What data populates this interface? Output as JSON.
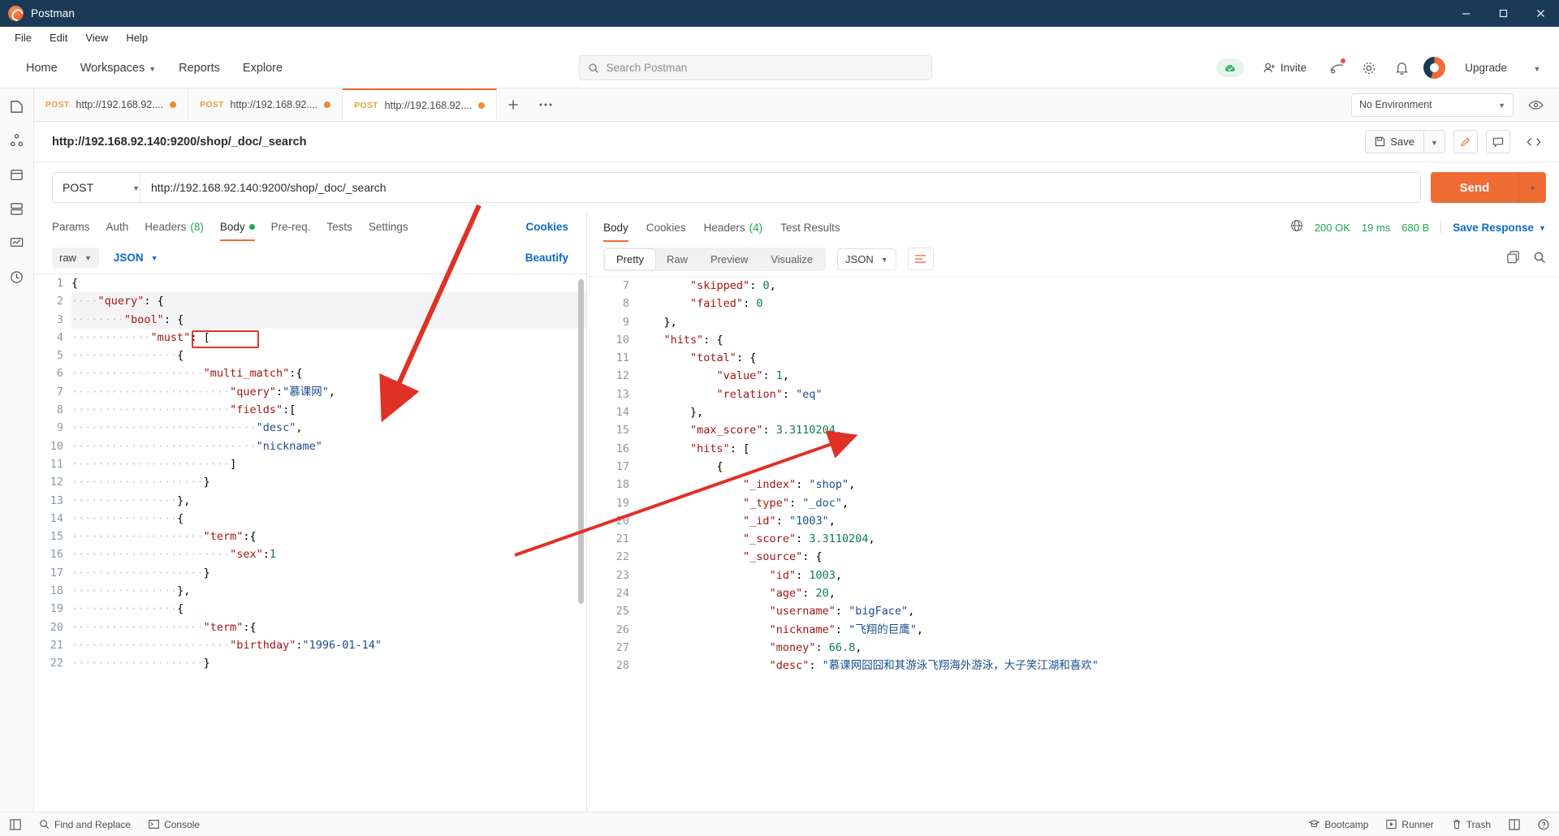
{
  "window": {
    "title": "Postman",
    "minimize": "–",
    "maximize": "❐",
    "close": "✕"
  },
  "menubar": [
    "File",
    "Edit",
    "View",
    "Help"
  ],
  "topnav": {
    "links": [
      "Home",
      "Workspaces",
      "Reports",
      "Explore"
    ],
    "search_placeholder": "Search Postman",
    "invite_label": "Invite",
    "upgrade_label": "Upgrade"
  },
  "tabs": [
    {
      "method": "POST",
      "url": "http://192.168.92....",
      "active": false
    },
    {
      "method": "POST",
      "url": "http://192.168.92....",
      "active": false
    },
    {
      "method": "POST",
      "url": "http://192.168.92....",
      "active": true
    }
  ],
  "environment": {
    "selected": "No Environment"
  },
  "request": {
    "title": "http://192.168.92.140:9200/shop/_doc/_search",
    "save_label": "Save",
    "method": "POST",
    "url": "http://192.168.92.140:9200/shop/_doc/_search",
    "send_label": "Send",
    "tabs": [
      {
        "label": "Params",
        "active": false
      },
      {
        "label": "Auth",
        "active": false
      },
      {
        "label": "Headers",
        "count": "(8)",
        "active": false
      },
      {
        "label": "Body",
        "active": true,
        "dot": true
      },
      {
        "label": "Pre-req.",
        "active": false
      },
      {
        "label": "Tests",
        "active": false
      },
      {
        "label": "Settings",
        "active": false
      }
    ],
    "cookies_link": "Cookies",
    "body_mode": "raw",
    "body_language": "JSON",
    "beautify_label": "Beautify",
    "body_lines": [
      {
        "n": 1,
        "indent": 0,
        "text": "{"
      },
      {
        "n": 2,
        "indent": 1,
        "text": "\"query\": {"
      },
      {
        "n": 3,
        "indent": 2,
        "text": "\"bool\": {"
      },
      {
        "n": 4,
        "indent": 3,
        "text": "\"must\": ["
      },
      {
        "n": 5,
        "indent": 4,
        "text": "{"
      },
      {
        "n": 6,
        "indent": 5,
        "text": "\"multi_match\":{"
      },
      {
        "n": 7,
        "indent": 6,
        "text": "\"query\":\"慕课网\","
      },
      {
        "n": 8,
        "indent": 6,
        "text": "\"fields\":["
      },
      {
        "n": 9,
        "indent": 7,
        "text": "\"desc\","
      },
      {
        "n": 10,
        "indent": 7,
        "text": "\"nickname\""
      },
      {
        "n": 11,
        "indent": 6,
        "text": "]"
      },
      {
        "n": 12,
        "indent": 5,
        "text": "}"
      },
      {
        "n": 13,
        "indent": 4,
        "text": "},"
      },
      {
        "n": 14,
        "indent": 4,
        "text": "{"
      },
      {
        "n": 15,
        "indent": 5,
        "text": "\"term\":{"
      },
      {
        "n": 16,
        "indent": 6,
        "text": "\"sex\":1"
      },
      {
        "n": 17,
        "indent": 5,
        "text": "}"
      },
      {
        "n": 18,
        "indent": 4,
        "text": "},"
      },
      {
        "n": 19,
        "indent": 4,
        "text": "{"
      },
      {
        "n": 20,
        "indent": 5,
        "text": "\"term\":{"
      },
      {
        "n": 21,
        "indent": 6,
        "text": "\"birthday\":\"1996-01-14\""
      },
      {
        "n": 22,
        "indent": 5,
        "text": "}"
      }
    ],
    "annotation_box_label": "\"must\":"
  },
  "response": {
    "tabs": [
      {
        "label": "Body",
        "active": true
      },
      {
        "label": "Cookies",
        "active": false
      },
      {
        "label": "Headers",
        "count": "(4)",
        "active": false
      },
      {
        "label": "Test Results",
        "active": false
      }
    ],
    "status": "200 OK",
    "time": "19 ms",
    "size": "680 B",
    "save_response_label": "Save Response",
    "view_modes": [
      {
        "label": "Pretty",
        "active": true
      },
      {
        "label": "Raw",
        "active": false
      },
      {
        "label": "Preview",
        "active": false
      },
      {
        "label": "Visualize",
        "active": false
      }
    ],
    "language": "JSON",
    "body_lines": [
      {
        "n": 7,
        "indent": 2,
        "text": "\"skipped\": 0,"
      },
      {
        "n": 8,
        "indent": 2,
        "text": "\"failed\": 0"
      },
      {
        "n": 9,
        "indent": 1,
        "text": "},"
      },
      {
        "n": 10,
        "indent": 1,
        "text": "\"hits\": {"
      },
      {
        "n": 11,
        "indent": 2,
        "text": "\"total\": {"
      },
      {
        "n": 12,
        "indent": 3,
        "text": "\"value\": 1,"
      },
      {
        "n": 13,
        "indent": 3,
        "text": "\"relation\": \"eq\""
      },
      {
        "n": 14,
        "indent": 2,
        "text": "},"
      },
      {
        "n": 15,
        "indent": 2,
        "text": "\"max_score\": 3.3110204,"
      },
      {
        "n": 16,
        "indent": 2,
        "text": "\"hits\": ["
      },
      {
        "n": 17,
        "indent": 3,
        "text": "{"
      },
      {
        "n": 18,
        "indent": 4,
        "text": "\"_index\": \"shop\","
      },
      {
        "n": 19,
        "indent": 4,
        "text": "\"_type\": \"_doc\","
      },
      {
        "n": 20,
        "indent": 4,
        "text": "\"_id\": \"1003\","
      },
      {
        "n": 21,
        "indent": 4,
        "text": "\"_score\": 3.3110204,"
      },
      {
        "n": 22,
        "indent": 4,
        "text": "\"_source\": {"
      },
      {
        "n": 23,
        "indent": 5,
        "text": "\"id\": 1003,"
      },
      {
        "n": 24,
        "indent": 5,
        "text": "\"age\": 20,"
      },
      {
        "n": 25,
        "indent": 5,
        "text": "\"username\": \"bigFace\","
      },
      {
        "n": 26,
        "indent": 5,
        "text": "\"nickname\": \"飞翔的巨鹰\","
      },
      {
        "n": 27,
        "indent": 5,
        "text": "\"money\": 66.8,"
      },
      {
        "n": 28,
        "indent": 5,
        "text": "\"desc\": \"慕课网囧囧和其游泳飞翔海外游泳，大子笑江湖和喜欢\""
      }
    ]
  },
  "footer": {
    "find_replace": "Find and Replace",
    "console": "Console",
    "bootcamp": "Bootcamp",
    "runner": "Runner",
    "trash": "Trash"
  },
  "colors": {
    "accent": "#ef6c35",
    "titlebar": "#1b3a57",
    "link": "#0b6bcb",
    "success": "#1aa94e",
    "annotation": "#e03127"
  }
}
